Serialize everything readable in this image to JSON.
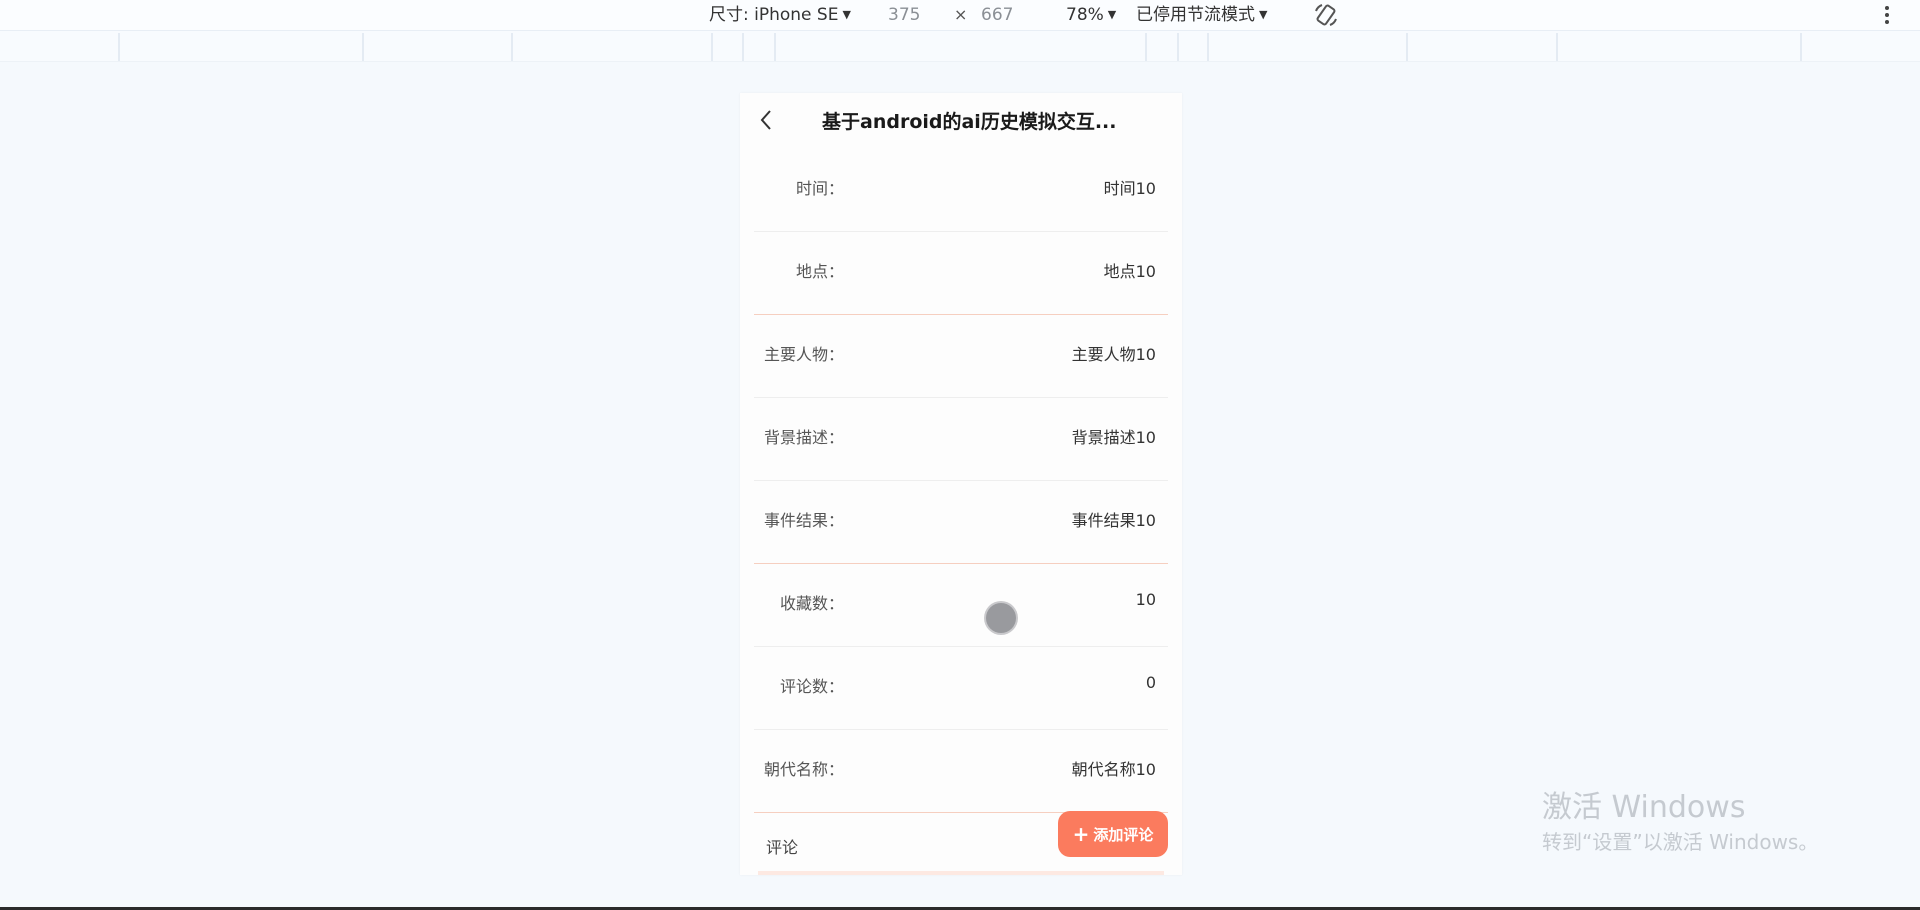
{
  "devtools": {
    "size_label": "尺寸: iPhone SE",
    "width_value": "375",
    "times": "×",
    "height_value": "667",
    "zoom": "78%",
    "throttle": "已停用节流模式",
    "icons": [
      "caret-down-icon",
      "rotate-icon",
      "more-vertical-icon"
    ]
  },
  "page": {
    "title": "基于android的ai历史模拟交互...",
    "rows": [
      {
        "label": "时间：",
        "value": "时间10"
      },
      {
        "label": "地点：",
        "value": "地点10"
      },
      {
        "label": "主要人物：",
        "value": "主要人物10"
      },
      {
        "label": "背景描述：",
        "value": "背景描述10"
      },
      {
        "label": "事件结果：",
        "value": "事件结果10"
      },
      {
        "label": "收藏数：",
        "value": "10"
      },
      {
        "label": "评论数：",
        "value": "0"
      },
      {
        "label": "朝代名称：",
        "value": "朝代名称10"
      }
    ],
    "comment_label": "评论",
    "add_comment_button": "添加评论",
    "accent_color": "#fb7b5e"
  },
  "watermark": {
    "title": "激活 Windows",
    "subtitle": "转到“设置”以激活 Windows。"
  }
}
